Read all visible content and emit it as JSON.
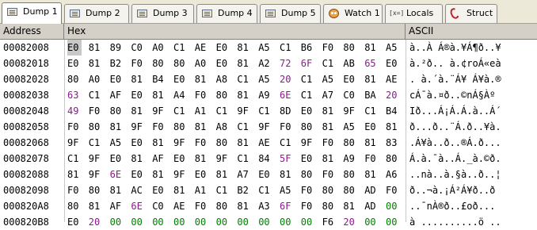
{
  "tabs": [
    {
      "label": "Dump 1",
      "icon": "dump-icon",
      "active": true
    },
    {
      "label": "Dump 2",
      "icon": "dump-icon",
      "active": false
    },
    {
      "label": "Dump 3",
      "icon": "dump-icon",
      "active": false
    },
    {
      "label": "Dump 4",
      "icon": "dump-icon",
      "active": false
    },
    {
      "label": "Dump 5",
      "icon": "dump-icon",
      "active": false
    },
    {
      "label": "Watch 1",
      "icon": "watch-icon",
      "active": false
    },
    {
      "label": "Locals",
      "icon": "locals-icon",
      "icon_text": "[x=]",
      "active": false
    },
    {
      "label": "Struct",
      "icon": "struct-icon",
      "active": false
    }
  ],
  "columns": {
    "address": "Address",
    "hex": "Hex",
    "ascii": "ASCII"
  },
  "colors": {
    "default": "#000000",
    "printable": "#8b1a8b",
    "zero": "#008000",
    "selection": "#c8c8c8"
  },
  "rows": [
    {
      "address": "00082008",
      "bytes": [
        "E0",
        "81",
        "89",
        "C0",
        "A0",
        "C1",
        "AE",
        "E0",
        "81",
        "A5",
        "C1",
        "B6",
        "F0",
        "80",
        "81",
        "A5"
      ],
      "ascii": "à..À Á®à.¥Á¶ð..¥"
    },
    {
      "address": "00082018",
      "bytes": [
        "E0",
        "81",
        "B2",
        "F0",
        "80",
        "80",
        "A0",
        "E0",
        "81",
        "A2",
        "72",
        "6F",
        "C1",
        "AB",
        "65",
        "E0"
      ],
      "ascii": "à.²ð.. à.¢roÁ«eà"
    },
    {
      "address": "00082028",
      "bytes": [
        "80",
        "A0",
        "E0",
        "81",
        "B4",
        "E0",
        "81",
        "A8",
        "C1",
        "A5",
        "20",
        "C1",
        "A5",
        "E0",
        "81",
        "AE"
      ],
      "ascii": ". à.´à.¨Á¥ Á¥à.®"
    },
    {
      "address": "00082038",
      "bytes": [
        "63",
        "C1",
        "AF",
        "E0",
        "81",
        "A4",
        "F0",
        "80",
        "81",
        "A9",
        "6E",
        "C1",
        "A7",
        "C0",
        "BA",
        "20"
      ],
      "ascii": "cÁ¯à.¤ð..©nÁ§Àº "
    },
    {
      "address": "00082048",
      "bytes": [
        "49",
        "F0",
        "80",
        "81",
        "9F",
        "C1",
        "A1",
        "C1",
        "9F",
        "C1",
        "8D",
        "E0",
        "81",
        "9F",
        "C1",
        "B4"
      ],
      "ascii": "Ið...Á¡Á.Á.à..Á´"
    },
    {
      "address": "00082058",
      "bytes": [
        "F0",
        "80",
        "81",
        "9F",
        "F0",
        "80",
        "81",
        "A8",
        "C1",
        "9F",
        "F0",
        "80",
        "81",
        "A5",
        "E0",
        "81"
      ],
      "ascii": "ð...ð..¨Á.ð..¥à."
    },
    {
      "address": "00082068",
      "bytes": [
        "9F",
        "C1",
        "A5",
        "E0",
        "81",
        "9F",
        "F0",
        "80",
        "81",
        "AE",
        "C1",
        "9F",
        "F0",
        "80",
        "81",
        "83"
      ],
      "ascii": ".Á¥à..ð..®Á.ð..."
    },
    {
      "address": "00082078",
      "bytes": [
        "C1",
        "9F",
        "E0",
        "81",
        "AF",
        "E0",
        "81",
        "9F",
        "C1",
        "84",
        "5F",
        "E0",
        "81",
        "A9",
        "F0",
        "80"
      ],
      "ascii": "Á.à.¯à..Á._à.©ð."
    },
    {
      "address": "00082088",
      "bytes": [
        "81",
        "9F",
        "6E",
        "E0",
        "81",
        "9F",
        "E0",
        "81",
        "A7",
        "E0",
        "81",
        "80",
        "F0",
        "80",
        "81",
        "A6"
      ],
      "ascii": "..nà..à.§à..ð..¦"
    },
    {
      "address": "00082098",
      "bytes": [
        "F0",
        "80",
        "81",
        "AC",
        "E0",
        "81",
        "A1",
        "C1",
        "B2",
        "C1",
        "A5",
        "F0",
        "80",
        "80",
        "AD",
        "F0"
      ],
      "ascii": "ð..¬à.¡Á²Á¥ð..­ð"
    },
    {
      "address": "000820A8",
      "bytes": [
        "80",
        "81",
        "AF",
        "6E",
        "C0",
        "AE",
        "F0",
        "80",
        "81",
        "A3",
        "6F",
        "F0",
        "80",
        "81",
        "AD",
        "00"
      ],
      "ascii": "..¯nÀ®ð..£oð..­."
    },
    {
      "address": "000820B8",
      "bytes": [
        "E0",
        "20",
        "00",
        "00",
        "00",
        "00",
        "00",
        "00",
        "00",
        "00",
        "00",
        "00",
        "F6",
        "20",
        "00",
        "00"
      ],
      "ascii": "à ..........ö .."
    }
  ]
}
